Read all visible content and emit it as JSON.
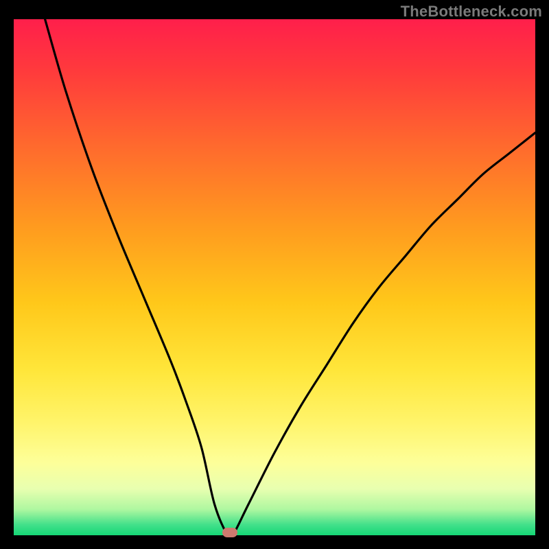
{
  "watermark": "TheBottleneck.com",
  "chart_data": {
    "type": "line",
    "title": "",
    "xlabel": "",
    "ylabel": "",
    "xlim": [
      0,
      100
    ],
    "ylim": [
      0,
      100
    ],
    "grid": false,
    "series": [
      {
        "name": "curve",
        "x": [
          6,
          10,
          15,
          20,
          25,
          30,
          33,
          36,
          38.5,
          41,
          42,
          45,
          50,
          55,
          60,
          65,
          70,
          75,
          80,
          85,
          90,
          95,
          100
        ],
        "values": [
          100,
          86,
          71,
          58,
          46,
          34,
          26,
          17,
          6,
          0,
          0,
          6,
          16,
          25,
          33,
          41,
          48,
          54,
          60,
          65,
          70,
          74,
          78
        ]
      }
    ],
    "marker": {
      "x": 41.5,
      "y": 0.5
    },
    "colors": {
      "curve": "#000000",
      "marker": "#cd7a6f",
      "gradient_top": "#ff1f4b",
      "gradient_bottom": "#15d675",
      "frame": "#000000"
    }
  }
}
